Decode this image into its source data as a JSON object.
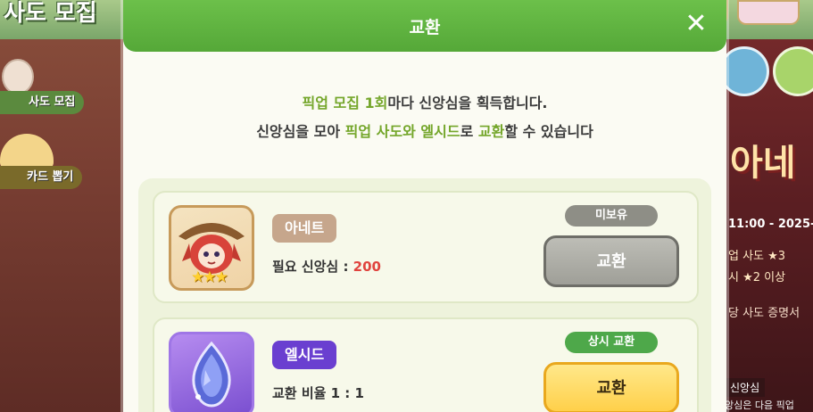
{
  "background": {
    "title": "사도 모집",
    "menu": [
      "사도 모집",
      "카드 뽑기"
    ],
    "event_title": "아네",
    "event_date": "11:00 - 2025-",
    "event_lines": [
      "업 사도 ★3",
      "시 ★2 이상"
    ],
    "event_desc": "당 사도 증명서",
    "bottom_label": "신앙심",
    "bottom_label2": "앙심은 다음 픽업"
  },
  "modal": {
    "title": "교환",
    "close_icon": "close-icon",
    "intro": {
      "line1_hl": "픽업 모집 1회",
      "line1_rest": "마다 신앙심을 획득합니다.",
      "line2_a": "신앙심을 모아 ",
      "line2_hl1": "픽업 사도와 엘시드",
      "line2_b": "로 ",
      "line2_hl2": "교환",
      "line2_c": "할 수 있습니다"
    },
    "items": [
      {
        "name": "아네트",
        "cost_label": "필요 신앙심 : ",
        "cost_value": "200",
        "status": "미보유",
        "button": "교환",
        "stars": "★★★"
      },
      {
        "name": "엘시드",
        "cost_label": "교환 비율 1 : 1",
        "cost_value": "",
        "status": "상시 교환",
        "button": "교환"
      }
    ]
  },
  "colors": {
    "header_green": "#5fb540",
    "highlight_green": "#74a62a",
    "cost_red": "#e0443e",
    "gem_purple": "#6a3fd0"
  }
}
